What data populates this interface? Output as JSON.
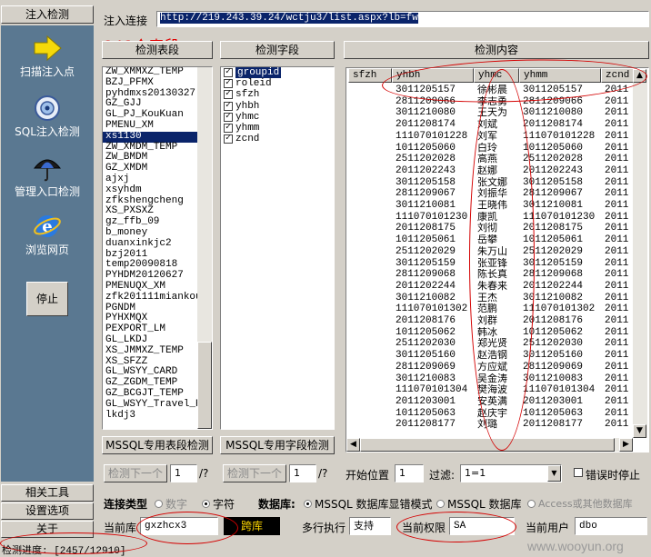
{
  "sidebar": {
    "header_label": "注入检测",
    "items": [
      {
        "label": "扫描注入点",
        "icon": "arrow-right-icon"
      },
      {
        "label": "SQL注入检测",
        "icon": "target-icon"
      },
      {
        "label": "管理入口检测",
        "icon": "umbrella-icon"
      },
      {
        "label": "浏览网页",
        "icon": "ie-browser-icon"
      }
    ],
    "stop_label": "停止",
    "bottom_buttons": [
      "相关工具",
      "设置选项",
      "关于"
    ]
  },
  "top": {
    "url_label": "注入连接",
    "url_value": "http://219.243.39.24/wctju3/list.aspx?lb=fw"
  },
  "annotation": "243个表段",
  "tables_panel": {
    "title": "检测表段",
    "items": [
      "ZW_XMMXZ_TEMP",
      "BZJ_PFMX",
      "pyhdmxs20130327",
      "GZ_GJJ",
      "GL_PJ_KouKuan",
      "PMENU_XM",
      "xs1130",
      "ZW_XMDM_TEMP",
      "ZW_BMDM",
      "GZ_XMDM",
      "ajxj",
      "xsyhdm",
      "zfkshengcheng",
      "XS_PXSXZ",
      "gz_ffb_09",
      "b_money",
      "duanxinkjc2",
      "bzj2011",
      "temp20090818",
      "PYHDM20120627",
      "PMENUQX_XM",
      "zfk201111miankou",
      "PGNDM",
      "PYHXMQX",
      "PEXPORT_LM",
      "GL_LKDJ",
      "XS_JMMXZ_TEMP",
      "XS_SFZZ",
      "GL_WSYY_CARD",
      "GZ_ZGDM_TEMP",
      "GZ_BCGJT_TEMP",
      "GL_WSYY_Travel_RY",
      "lkdj3"
    ],
    "selected": "xs1130",
    "button": "MSSQL专用表段检测"
  },
  "fields_panel": {
    "title": "检测字段",
    "items": [
      "groupid",
      "roleid",
      "sfzh",
      "yhbh",
      "yhmc",
      "yhmm",
      "zcnd"
    ],
    "selected": "groupid",
    "button": "MSSQL专用字段检测"
  },
  "content_panel": {
    "title": "检测内容",
    "columns": [
      "sfzh",
      "yhbh",
      "yhmc",
      "yhmm",
      "zcnd"
    ],
    "rows": [
      [
        "",
        "3011205157",
        "徐彬晨",
        "3011205157",
        "2011"
      ],
      [
        "",
        "2811209066",
        "李志勇",
        "2811209066",
        "2011"
      ],
      [
        "",
        "3011210080",
        "王天为",
        "3011210080",
        "2011"
      ],
      [
        "",
        "2011208174",
        "刘斌",
        "2011208174",
        "2011"
      ],
      [
        "",
        "111070101228",
        "刘军",
        "111070101228",
        "2011"
      ],
      [
        "",
        "1011205060",
        "白玲",
        "1011205060",
        "2011"
      ],
      [
        "",
        "2511202028",
        "高燕",
        "2511202028",
        "2011"
      ],
      [
        "",
        "2011202243",
        "赵娜",
        "2011202243",
        "2011"
      ],
      [
        "",
        "3011205158",
        "张文娜",
        "3011205158",
        "2011"
      ],
      [
        "",
        "2811209067",
        "刘振华",
        "2811209067",
        "2011"
      ],
      [
        "",
        "3011210081",
        "王晓伟",
        "3011210081",
        "2011"
      ],
      [
        "",
        "111070101230",
        "康凯",
        "111070101230",
        "2011"
      ],
      [
        "",
        "2011208175",
        "刘彻",
        "2011208175",
        "2011"
      ],
      [
        "",
        "1011205061",
        "岳攀",
        "1011205061",
        "2011"
      ],
      [
        "",
        "2511202029",
        "朱万山",
        "2511202029",
        "2011"
      ],
      [
        "",
        "3011205159",
        "张亚锋",
        "3011205159",
        "2011"
      ],
      [
        "",
        "2811209068",
        "陈长真",
        "2811209068",
        "2011"
      ],
      [
        "",
        "2011202244",
        "朱春来",
        "2011202244",
        "2011"
      ],
      [
        "",
        "3011210082",
        "王杰",
        "3011210082",
        "2011"
      ],
      [
        "",
        "111070101302",
        "范鹏",
        "111070101302",
        "2011"
      ],
      [
        "",
        "2011208176",
        "刘群",
        "2011208176",
        "2011"
      ],
      [
        "",
        "1011205062",
        "韩冰",
        "1011205062",
        "2011"
      ],
      [
        "",
        "2511202030",
        "郑光贤",
        "2511202030",
        "2011"
      ],
      [
        "",
        "3011205160",
        "赵浩钢",
        "3011205160",
        "2011"
      ],
      [
        "",
        "2811209069",
        "方应斌",
        "2811209069",
        "2011"
      ],
      [
        "",
        "3011210083",
        "吴金涛",
        "3011210083",
        "2011"
      ],
      [
        "",
        "111070101304",
        "樊海波",
        "111070101304",
        "2011"
      ],
      [
        "",
        "2011203001",
        "安英满",
        "2011203001",
        "2011"
      ],
      [
        "",
        "1011205063",
        "赵庆宇",
        "1011205063",
        "2011"
      ],
      [
        "",
        "2011208177",
        "刘璐",
        "2011208177",
        "2011"
      ]
    ]
  },
  "controls": {
    "next1_label": "检测下一个",
    "next1_value": "1",
    "next1_total": "/?",
    "next2_label": "检测下一个",
    "next2_value": "1",
    "next2_total": "/?",
    "start_label": "开始位置",
    "start_value": "1",
    "filter_label": "过滤:",
    "filter_value": "1=1",
    "stop_on_error_label": "错误时停止"
  },
  "options": {
    "conn_type_label": "连接类型",
    "conn_types": [
      "数字",
      "字符"
    ],
    "conn_type_selected": "字符",
    "db_label": "数据库:",
    "db_types": [
      "MSSQL 数据库显错模式",
      "MSSQL 数据库",
      "Access或其他数据库"
    ],
    "db_selected": "MSSQL 数据库显错模式"
  },
  "status": {
    "current_db_label": "当前库",
    "current_db_value": "gxzhcx3",
    "cross_db_label": "跨库",
    "multi_exec_label": "多行执行",
    "multi_exec_value": "支持",
    "perm_label": "当前权限",
    "perm_value": "SA",
    "user_label": "当前用户",
    "user_value": "dbo",
    "progress_text": "检测进度: [2457/12910]",
    "watermark": "www.wooyun.org"
  }
}
